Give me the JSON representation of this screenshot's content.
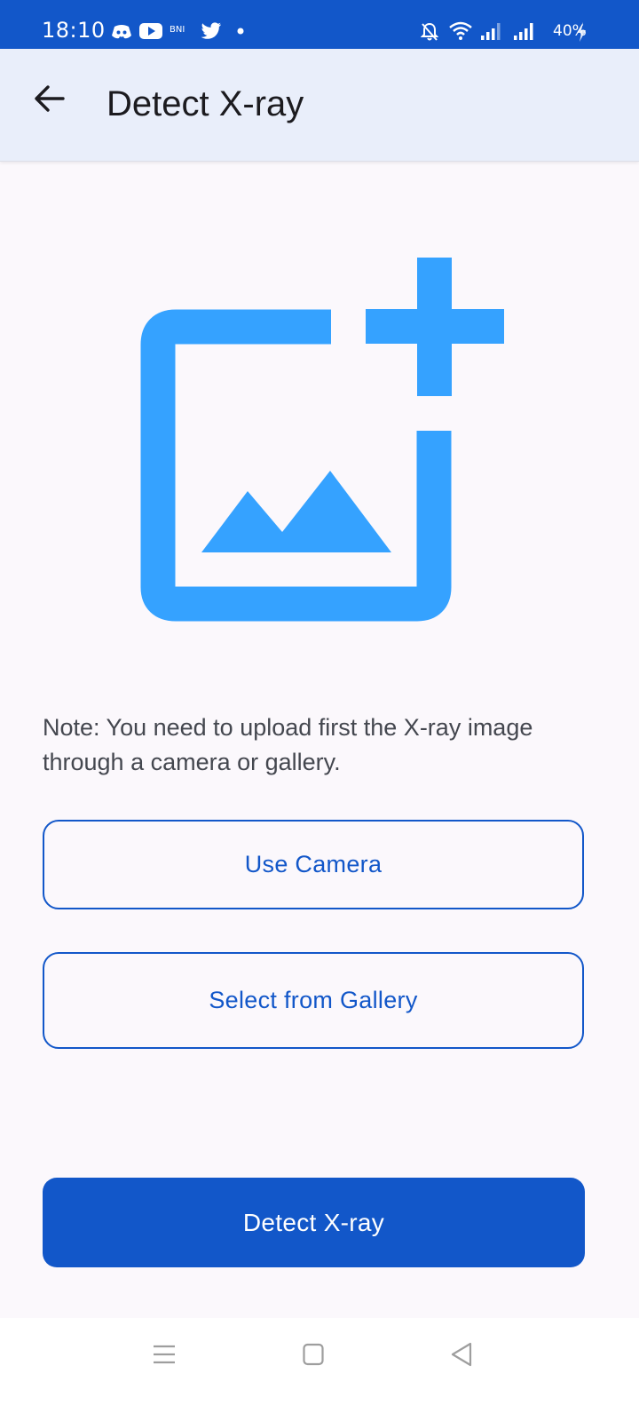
{
  "status_bar": {
    "time": "18:10",
    "notification_icons": [
      "discord-icon",
      "youtube-icon",
      "bni-icon",
      "twitter-icon",
      "dot-icon"
    ],
    "bni_label": "BNI",
    "system_icons": [
      "bell-off-icon",
      "wifi-icon",
      "signal-icon",
      "signal-icon",
      "battery-charging-icon"
    ],
    "battery": "40%"
  },
  "app_bar": {
    "back_icon": "arrow-back-icon",
    "title": "Detect X-ray"
  },
  "illustration": {
    "icon": "add-photo-icon",
    "color": "#35a2ff"
  },
  "note": "Note: You need to upload first the X-ray image through a camera or gallery.",
  "buttons": {
    "camera": "Use Camera",
    "gallery": "Select from Gallery",
    "detect": "Detect X-ray"
  },
  "colors": {
    "primary": "#1257c9",
    "status_bar": "#1257c9",
    "app_bar": "#e9eefa",
    "background": "#fbf8fc"
  },
  "nav_bar": [
    "menu-icon",
    "home-square-icon",
    "back-triangle-icon"
  ]
}
